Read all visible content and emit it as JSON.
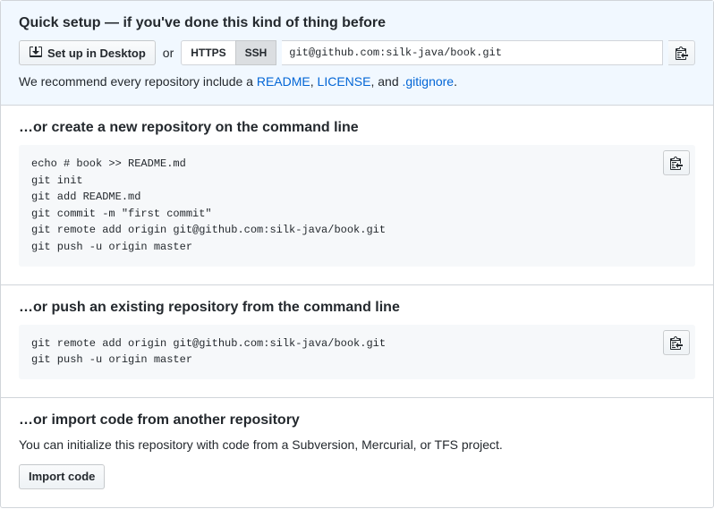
{
  "quickSetup": {
    "title": "Quick setup — if you've done this kind of thing before",
    "desktopBtn": "Set up in Desktop",
    "or": "or",
    "httpsLabel": "HTTPS",
    "sshLabel": "SSH",
    "url": "git@github.com:silk-java/book.git",
    "recPrefix": "We recommend every repository include a ",
    "readmeLink": "README",
    "comma1": ", ",
    "licenseLink": "LICENSE",
    "andText": ", and ",
    "gitignoreLink": ".gitignore",
    "period": "."
  },
  "createSection": {
    "title": "…or create a new repository on the command line",
    "code": "echo # book >> README.md\ngit init\ngit add README.md\ngit commit -m \"first commit\"\ngit remote add origin git@github.com:silk-java/book.git\ngit push -u origin master"
  },
  "pushSection": {
    "title": "…or push an existing repository from the command line",
    "code": "git remote add origin git@github.com:silk-java/book.git\ngit push -u origin master"
  },
  "importSection": {
    "title": "…or import code from another repository",
    "text": "You can initialize this repository with code from a Subversion, Mercurial, or TFS project.",
    "btn": "Import code"
  }
}
